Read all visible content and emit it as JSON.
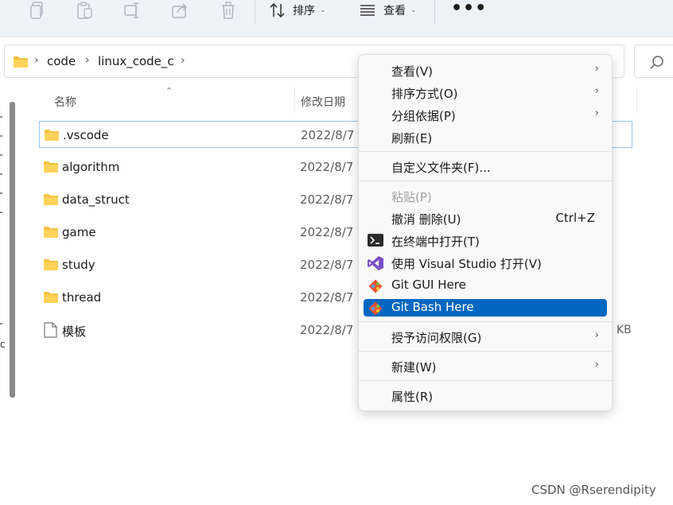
{
  "toolbar": {
    "sort_label": "排序",
    "view_label": "查看",
    "more_label": "•••"
  },
  "address": {
    "crumbs": [
      "code",
      "linux_code_c"
    ]
  },
  "columns": {
    "name": "名称",
    "modified": "修改日期"
  },
  "files": [
    {
      "name": ".vscode",
      "date": "2022/8/7",
      "type": "folder"
    },
    {
      "name": "algorithm",
      "date": "2022/8/7",
      "type": "folder"
    },
    {
      "name": "data_struct",
      "date": "2022/8/7",
      "type": "folder"
    },
    {
      "name": "game",
      "date": "2022/8/7",
      "type": "folder"
    },
    {
      "name": "study",
      "date": "2022/8/7",
      "type": "folder"
    },
    {
      "name": "thread",
      "date": "2022/8/7",
      "type": "folder"
    },
    {
      "name": "模板",
      "date": "2022/8/7",
      "type": "file",
      "size_suffix": "KB"
    }
  ],
  "left_edge_char": "c",
  "context_menu": {
    "view": "查看(V)",
    "sort_by": "排序方式(O)",
    "group_by": "分组依据(P)",
    "refresh": "刷新(E)",
    "customize": "自定义文件夹(F)...",
    "paste": "粘贴(P)",
    "undo": "撤消 删除(U)",
    "undo_shortcut": "Ctrl+Z",
    "open_terminal": "在终端中打开(T)",
    "open_vs": "使用 Visual Studio 打开(V)",
    "git_gui": "Git GUI Here",
    "git_bash": "Git Bash Here",
    "grant_access": "授予访问权限(G)",
    "new": "新建(W)",
    "properties": "属性(R)"
  },
  "colors": {
    "highlight": "#0067c0",
    "folder": "#f5c341",
    "selection_border": "#99c4ee"
  },
  "watermark": "CSDN @Rserendipity"
}
